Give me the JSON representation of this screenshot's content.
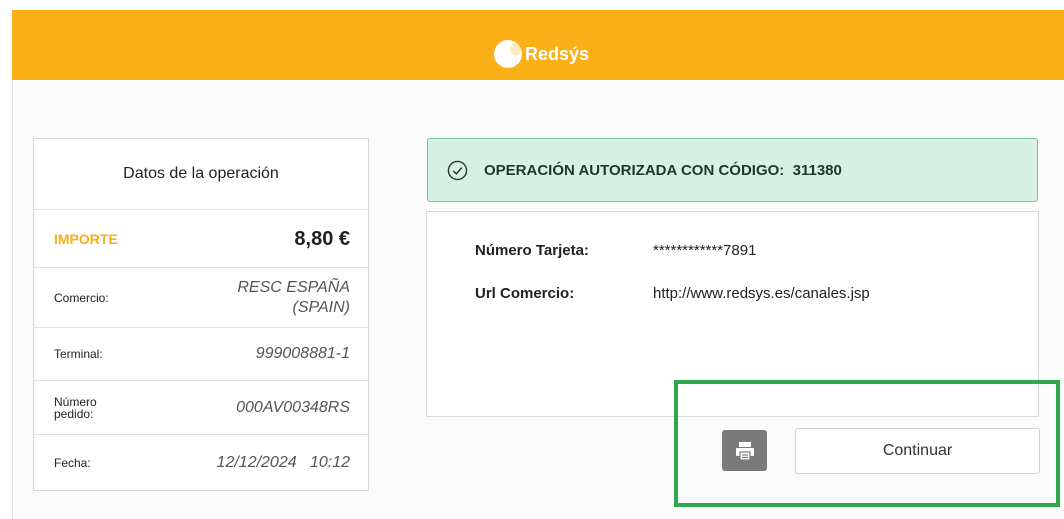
{
  "header": {
    "brand": "Redsýs",
    "brand_color": "#fbb017"
  },
  "operation": {
    "title": "Datos de la operación",
    "importe_label": "IMPORTE",
    "importe_value": "8,80 €",
    "comercio_label": "Comercio:",
    "comercio_value_line1": "RESC ESPAÑA",
    "comercio_value_line2": "(SPAIN)",
    "terminal_label": "Terminal:",
    "terminal_value": "999008881-1",
    "pedido_label": "Número pedido:",
    "pedido_value": "000AV00348RS",
    "fecha_label": "Fecha:",
    "fecha_value": "12/12/2024   10:12"
  },
  "status": {
    "message": "OPERACIÓN AUTORIZADA CON CÓDIGO:  311380",
    "icon": "check-circle-icon",
    "color": "#d8f1e5"
  },
  "details": {
    "tarjeta_label": "Número Tarjeta:",
    "tarjeta_value": "************7891",
    "url_label": "Url Comercio:",
    "url_value": "http://www.redsys.es/canales.jsp"
  },
  "actions": {
    "print_icon": "printer-icon",
    "continue_label": "Continuar"
  },
  "highlight_color": "#2ea84a"
}
